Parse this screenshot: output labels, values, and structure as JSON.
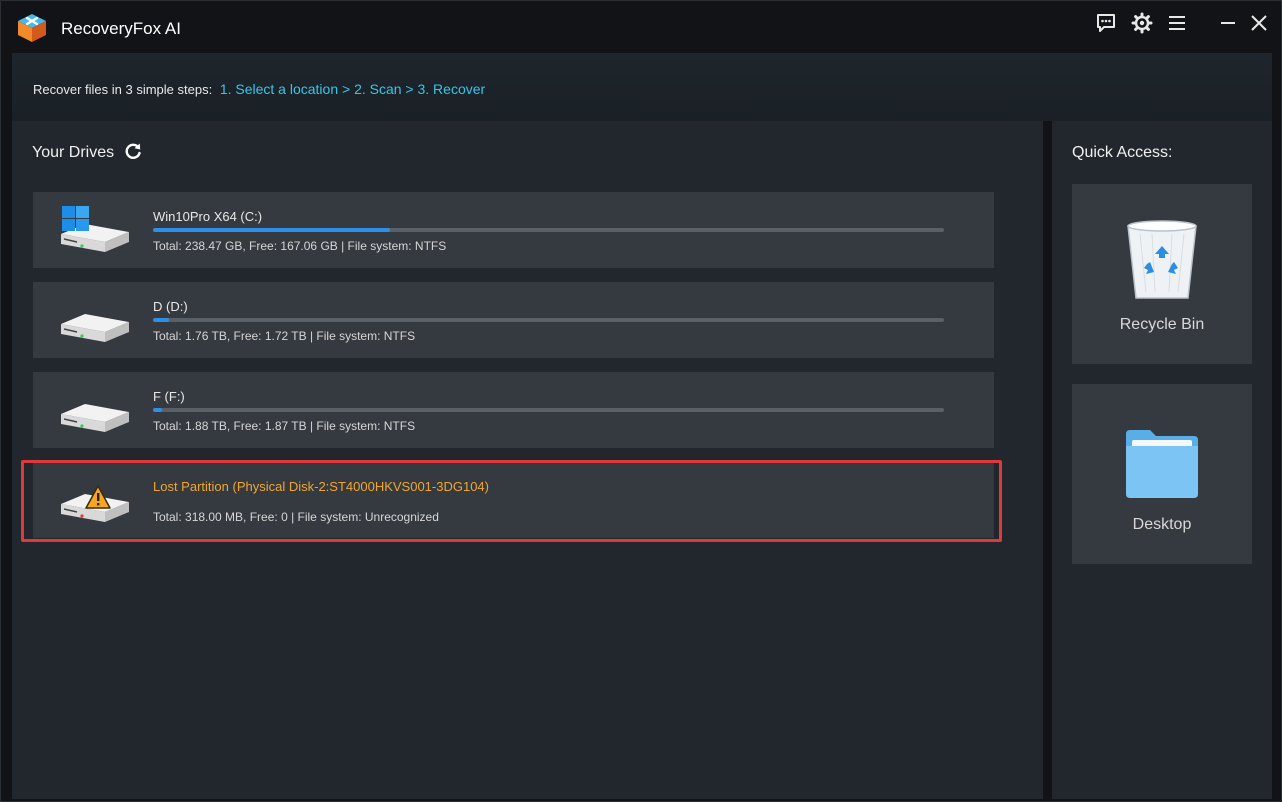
{
  "app": {
    "title": "RecoveryFox AI"
  },
  "titlebar": {
    "icons": [
      "feedback-icon",
      "settings-icon",
      "menu-icon",
      "minimize-icon",
      "close-icon"
    ]
  },
  "banner": {
    "prefix": "Recover files in 3 simple steps:",
    "steps": "1. Select a location > 2. Scan > 3. Recover"
  },
  "drives": {
    "title": "Your Drives",
    "items": [
      {
        "name": "Win10Pro X64 (C:)",
        "info": "Total: 238.47 GB, Free: 167.06 GB | File system: NTFS",
        "used_fraction": 0.3,
        "type": "system"
      },
      {
        "name": "D (D:)",
        "info": "Total: 1.76 TB, Free: 1.72 TB | File system: NTFS",
        "used_fraction": 0.02,
        "type": "disk"
      },
      {
        "name": "F (F:)",
        "info": "Total: 1.88 TB, Free: 1.87 TB | File system: NTFS",
        "used_fraction": 0.005,
        "type": "disk"
      },
      {
        "name": "Lost Partition (Physical Disk-2:ST4000HKVS001-3DG104)",
        "info": "Total: 318.00 MB, Free: 0 | File system: Unrecognized",
        "used_fraction": null,
        "type": "lost"
      }
    ]
  },
  "quick_access": {
    "title": "Quick Access:",
    "items": [
      {
        "label": "Recycle Bin",
        "icon": "recycle-bin-icon"
      },
      {
        "label": "Desktop",
        "icon": "folder-icon"
      }
    ]
  },
  "colors": {
    "accent": "#37c6e8",
    "progress": "#2f8ee6",
    "warning": "#f0a630",
    "highlight": "#e0393d"
  }
}
